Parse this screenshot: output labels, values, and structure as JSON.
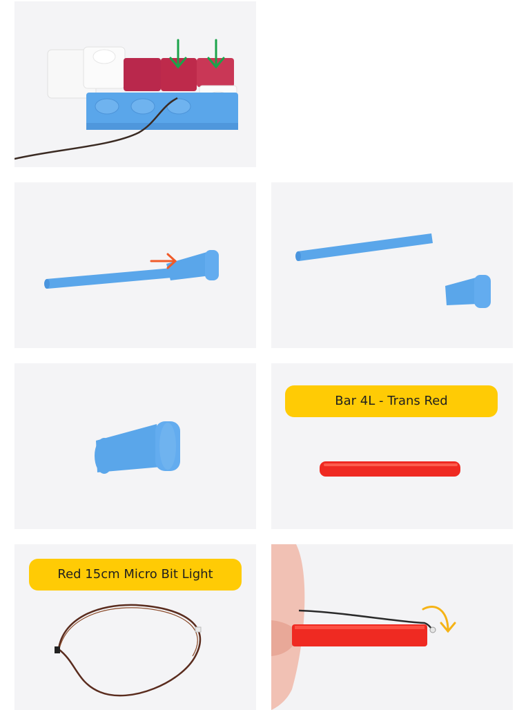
{
  "steps": [
    {
      "id": 1,
      "label": "",
      "arrows": [
        "down-arrow-icon",
        "down-arrow-icon"
      ],
      "accent": "#1aa34a"
    },
    {
      "id": 2,
      "label": "",
      "arrows": [
        "right-arrow-icon"
      ],
      "accent": "#f05a28"
    },
    {
      "id": 3,
      "label": ""
    },
    {
      "id": 4,
      "label": ""
    },
    {
      "id": 5,
      "label": "Bar 4L - Trans Red"
    },
    {
      "id": 6,
      "label": "Red 15cm Micro Bit Light"
    },
    {
      "id": 7,
      "label": "",
      "arrows": [
        "curved-down-arrow-icon"
      ],
      "accent": "#f5b316"
    }
  ],
  "colors": {
    "label_bg": "#ffcb05",
    "piece_blue": "#5aa6ea",
    "piece_red": "#ef2a22",
    "card_bg": "#f4f4f6"
  }
}
